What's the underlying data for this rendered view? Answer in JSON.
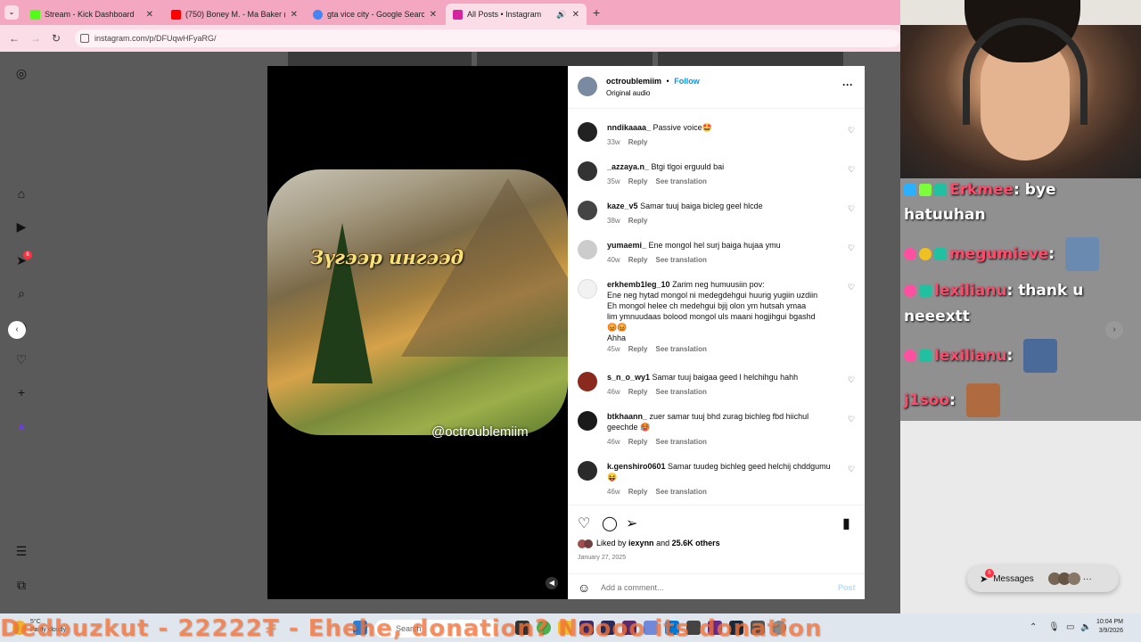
{
  "browser": {
    "tabs": [
      {
        "title": "Stream - Kick Dashboard",
        "icon": "kick-icon",
        "color": "#53fc18"
      },
      {
        "title": "(750) Boney M. - Ma Baker (ZDF",
        "icon": "youtube-icon",
        "color": "#ff0000"
      },
      {
        "title": "gta vice city - Google Search",
        "icon": "google-icon",
        "color": "#4285f4"
      },
      {
        "title": "All Posts • Instagram",
        "icon": "instagram-icon",
        "color": "#d6249f"
      }
    ],
    "url": "instagram.com/p/DFUqwHFyaRG/"
  },
  "left_nav": {
    "notification_count": "6"
  },
  "video": {
    "title": "Зүгээр ингээд",
    "watermark": "@octroublemiim"
  },
  "post": {
    "username": "octroublemiim",
    "separator": "•",
    "follow_label": "Follow",
    "audio": "Original audio",
    "reply_label": "Reply",
    "translate_label": "See translation",
    "comments": [
      {
        "user": "nndikaaaa_",
        "text": "Passive voice🤩",
        "age": "33w",
        "translate": false
      },
      {
        "user": "_azzaya.n_",
        "text": "Btgi tlgoi erguuld bai",
        "age": "35w",
        "translate": true
      },
      {
        "user": "kaze_v5",
        "text": "Samar tuuj baiga bicleg geel hlcde",
        "age": "38w",
        "translate": false
      },
      {
        "user": "yumaemi_",
        "text": "Ene mongol hel surj baiga hujaa ymu",
        "age": "40w",
        "translate": true
      },
      {
        "user": "erkhemb1leg_10",
        "text": "Zarim neg humuusiin pov:",
        "lines": [
          "Ene neg hytad mongol ni medegdehgui huurig yugiin uzdiin",
          "Eh mongol helee ch medehgui bjij olon ym hutsah ymaa",
          "lim ymnuudaas bolood mongol uls maani hogjihgui bgashd",
          "😡😡",
          "Ahha"
        ],
        "age": "45w",
        "translate": true
      },
      {
        "user": "s_n_o_wy1",
        "text": "Samar tuuj baigaa geed l helchihgu hahh",
        "age": "46w",
        "translate": true
      },
      {
        "user": "btkhaann_",
        "text": "zuer samar tuuj bhd zurag bichleg fbd hiichul",
        "lines": [
          "geechde 🥵"
        ],
        "age": "46w",
        "translate": true
      },
      {
        "user": "k.genshiro0601",
        "text": "Samar tuudeg bichleg geed helchij chddgumu",
        "lines": [
          "😝"
        ],
        "age": "46w",
        "translate": true
      }
    ],
    "liked_by_prefix": "Liked by",
    "liked_by_user": "iexynn",
    "liked_by_and": "and",
    "likes_count": "25.6K others",
    "date": "January 27, 2025",
    "add_comment_placeholder": "Add a comment...",
    "post_label": "Post"
  },
  "chat": {
    "messages": [
      {
        "user": "Erkmee",
        "text": ": bye",
        "text2": "hatuuhan"
      },
      {
        "user": "megumieve",
        "text": ":"
      },
      {
        "user": "lexilianu",
        "text": ": thank u",
        "text2": "neeextt"
      },
      {
        "user": "lexilianu",
        "text": ":"
      },
      {
        "user": "j1soo",
        "text": ":"
      }
    ]
  },
  "messages_widget": {
    "label": "Messages",
    "count": "6"
  },
  "taskbar": {
    "ticker": "Dedbuzkut - 22222₮ - Ehehe, donation? Noooo its donation",
    "weather_temp": "5°C",
    "weather_desc": "Partly cloudy",
    "search_placeholder": "Search",
    "time": "10:04 PM",
    "date": "3/9/2026"
  }
}
